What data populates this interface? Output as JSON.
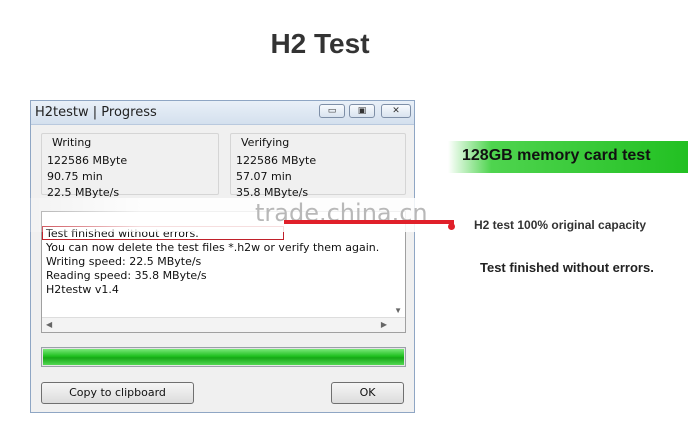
{
  "page": {
    "title": "H2 Test"
  },
  "window": {
    "title": "H2testw | Progress",
    "controls": {
      "minimize": "▭",
      "maximize": "▣",
      "close": "✕"
    },
    "writing": {
      "label": "Writing",
      "size": "122586 MByte",
      "time": "90.75 min",
      "speed": "22.5 MByte/s"
    },
    "verifying": {
      "label": "Verifying",
      "size": "122586 MByte",
      "time": "57.07 min",
      "speed": "35.8 MByte/s"
    },
    "log": {
      "lines": [
        "Test finished without errors.",
        "You can now delete the test files *.h2w or verify them again.",
        "Writing speed: 22.5 MByte/s",
        "Reading speed: 35.8 MByte/s",
        "H2testw v1.4"
      ]
    },
    "progress": {
      "fraction": 1.0
    },
    "buttons": {
      "copy": "Copy to clipboard",
      "ok": "OK"
    }
  },
  "watermark": "trade.china.cn",
  "annotations": {
    "badge": "128GB memory card test",
    "subtext": "H2 test 100% original capacity",
    "result": "Test finished without errors."
  },
  "colors": {
    "accent_green": "#22c022",
    "highlight_red": "#e0202a"
  }
}
